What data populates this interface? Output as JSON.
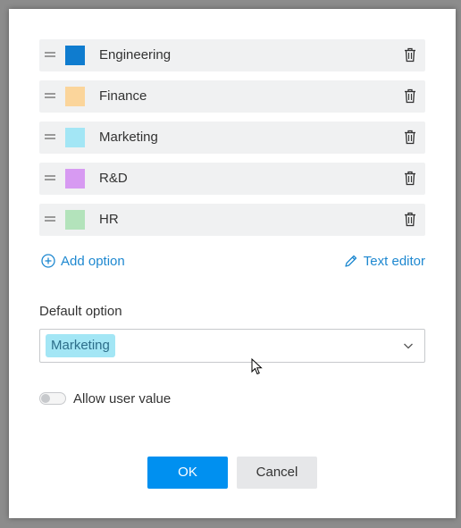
{
  "options": [
    {
      "label": "Engineering",
      "color": "#0f7ccf"
    },
    {
      "label": "Finance",
      "color": "#fbd59b"
    },
    {
      "label": "Marketing",
      "color": "#a3e6f5"
    },
    {
      "label": "R&D",
      "color": "#d79af2"
    },
    {
      "label": "HR",
      "color": "#b3e3bb"
    }
  ],
  "actions": {
    "add_option": "Add option",
    "text_editor": "Text editor"
  },
  "default_option": {
    "label": "Default option",
    "selected": "Marketing",
    "selected_color": "#a3e6f5"
  },
  "allow_user_value": {
    "label": "Allow user value",
    "enabled": false
  },
  "buttons": {
    "ok": "OK",
    "cancel": "Cancel"
  },
  "icons": [
    "drag-handle-icon",
    "trash-icon",
    "plus-circle-icon",
    "pencil-icon",
    "chevron-down-icon"
  ]
}
